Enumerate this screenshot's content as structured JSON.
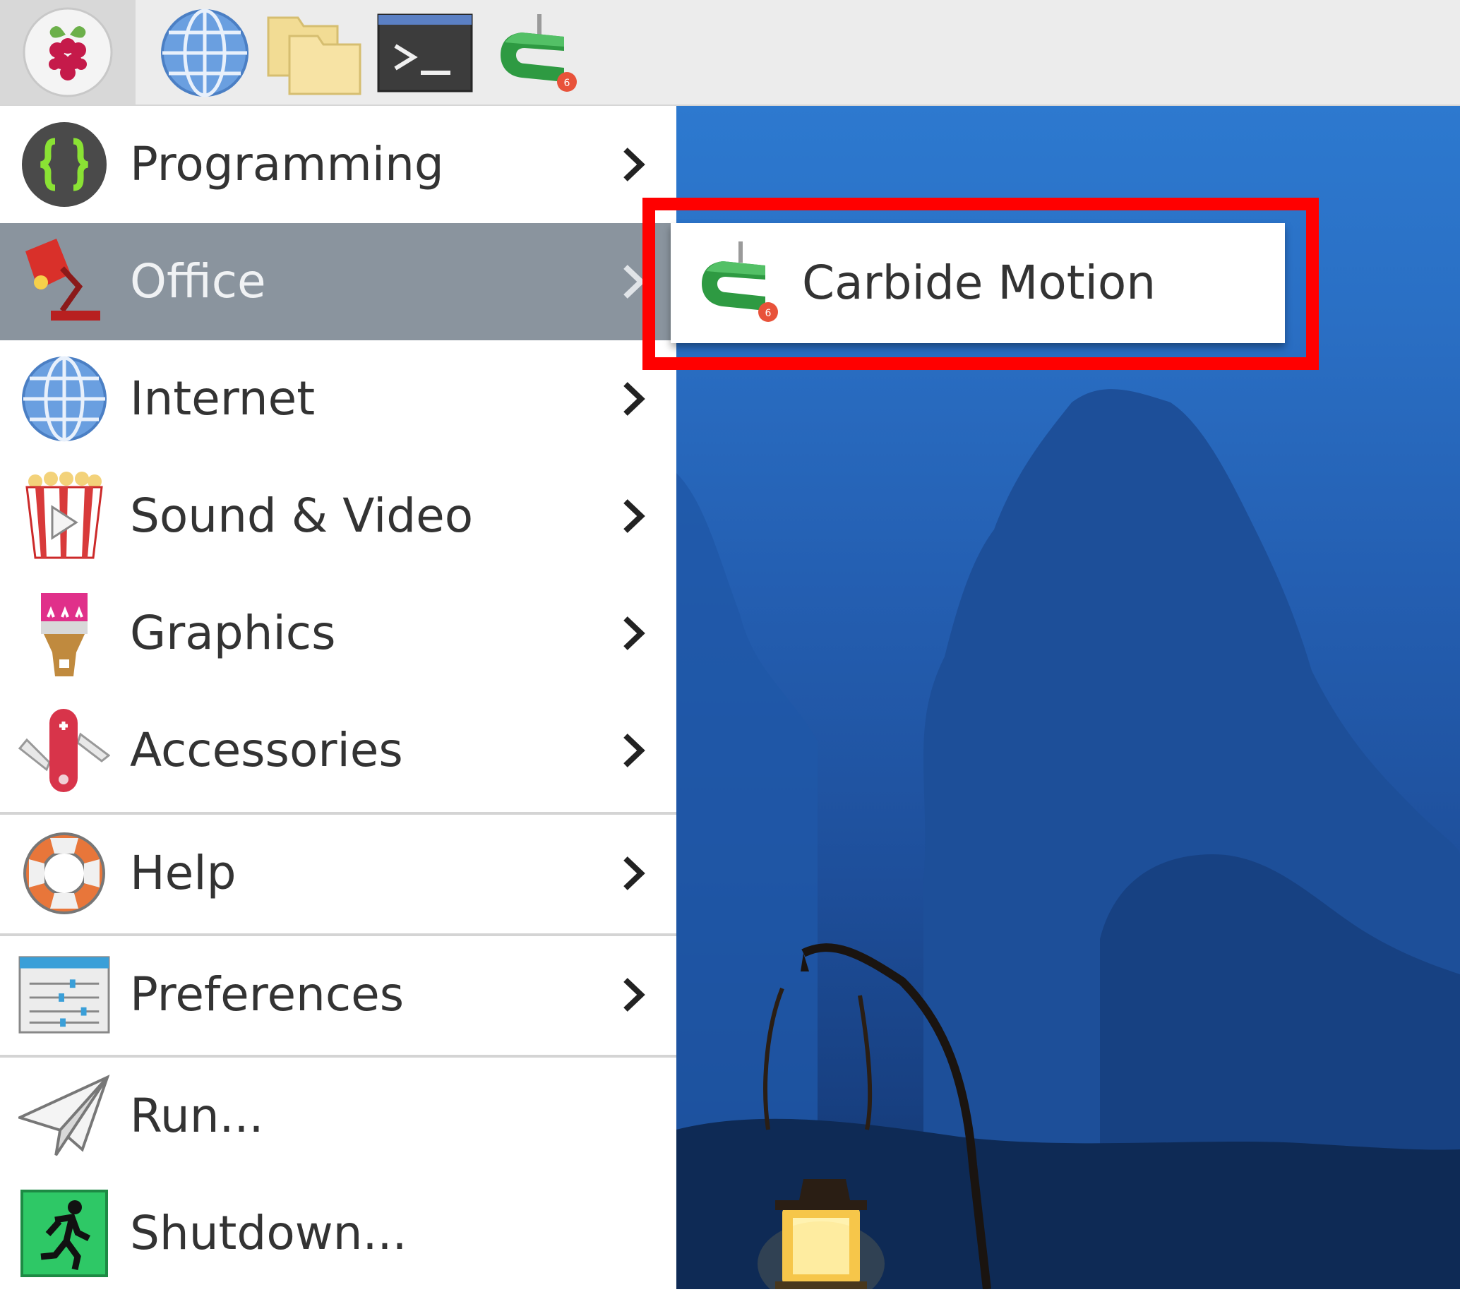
{
  "taskbar": {
    "buttons": [
      {
        "name": "raspberry-menu",
        "icon": "raspberry-icon"
      },
      {
        "name": "web-browser",
        "icon": "globe-icon"
      },
      {
        "name": "file-manager",
        "icon": "folder-icon"
      },
      {
        "name": "terminal",
        "icon": "terminal-icon"
      },
      {
        "name": "carbide-motion",
        "icon": "carbide-motion-icon"
      }
    ]
  },
  "menu": {
    "items": [
      {
        "label": "Programming",
        "icon": "programming-braces-icon",
        "has_submenu": true
      },
      {
        "label": "Office",
        "icon": "desk-lamp-icon",
        "has_submenu": true,
        "active": true
      },
      {
        "label": "Internet",
        "icon": "globe-icon",
        "has_submenu": true
      },
      {
        "label": "Sound & Video",
        "icon": "popcorn-play-icon",
        "has_submenu": true
      },
      {
        "label": "Graphics",
        "icon": "paintbrush-icon",
        "has_submenu": true
      },
      {
        "label": "Accessories",
        "icon": "swiss-knife-icon",
        "has_submenu": true
      },
      {
        "label": "Help",
        "icon": "lifebuoy-icon",
        "has_submenu": true
      },
      {
        "label": "Preferences",
        "icon": "settings-sliders-icon",
        "has_submenu": true
      },
      {
        "label": "Run...",
        "icon": "paper-plane-icon",
        "has_submenu": false
      },
      {
        "label": "Shutdown...",
        "icon": "exit-running-man-icon",
        "has_submenu": false
      }
    ]
  },
  "submenu": {
    "items": [
      {
        "label": "Carbide Motion",
        "icon": "carbide-motion-icon"
      }
    ]
  },
  "colors": {
    "active_item_bg": "#8a949e",
    "highlight_box": "#ff0000",
    "wallpaper_top": "#2d79cf",
    "wallpaper_bottom": "#10305f"
  }
}
